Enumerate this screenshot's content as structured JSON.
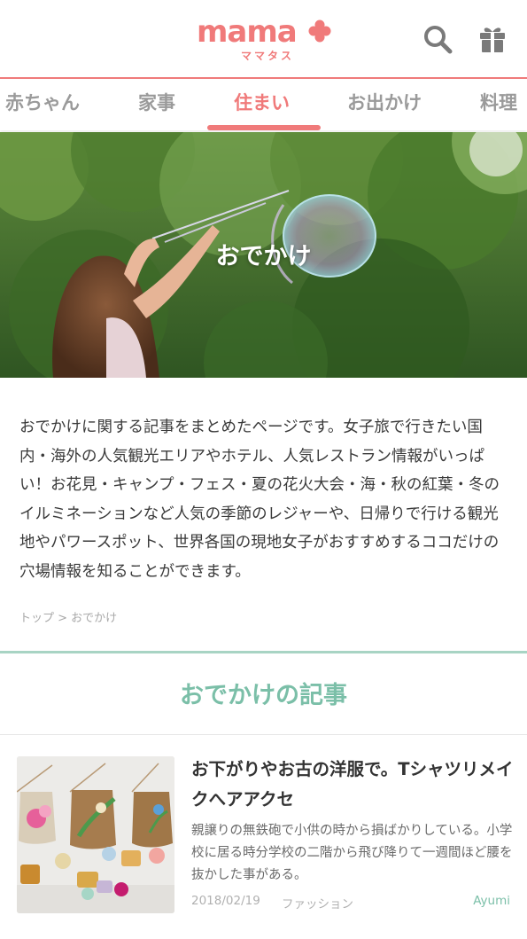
{
  "header": {
    "logo_text": "mama",
    "logo_sub": "ママタス",
    "search_icon": "search-icon",
    "gift_icon": "gift-icon",
    "accent_color": "#f07a7a"
  },
  "nav": {
    "items": [
      {
        "label": "赤ちゃん"
      },
      {
        "label": "家事"
      },
      {
        "label": "住まい"
      },
      {
        "label": "お出かけ"
      },
      {
        "label": "料理"
      }
    ],
    "active_index": 2
  },
  "hero": {
    "title": "おでかけ"
  },
  "intro": {
    "text": "おでかけに関する記事をまとめたページです。女子旅で行きたい国内・海外の人気観光エリアやホテル、人気レストラン情報がいっぱい！お花見・キャンプ・フェス・夏の花火大会・海・秋の紅葉・冬のイルミネーションなど人気の季節のレジャーや、日帰りで行ける観光地やパワースポット、世界各国の現地女子がおすすめするココだけの穴場情報を知ることができます。"
  },
  "breadcrumb": {
    "text": "トップ > おでかけ"
  },
  "section": {
    "title": "おでかけの記事",
    "accent_color": "#7bbfa8"
  },
  "articles": [
    {
      "title": "お下がりやお古の洋服で。Tシャツリメイクへアアクセ",
      "excerpt": "親譲りの無鉄砲で小供の時から損ばかりしている。小学校に居る時分学校の二階から飛び降りて一週間ほど腰を抜かした事がある。",
      "date": "2018/02/19",
      "category": "ファッション",
      "author": "Ayumi"
    }
  ]
}
